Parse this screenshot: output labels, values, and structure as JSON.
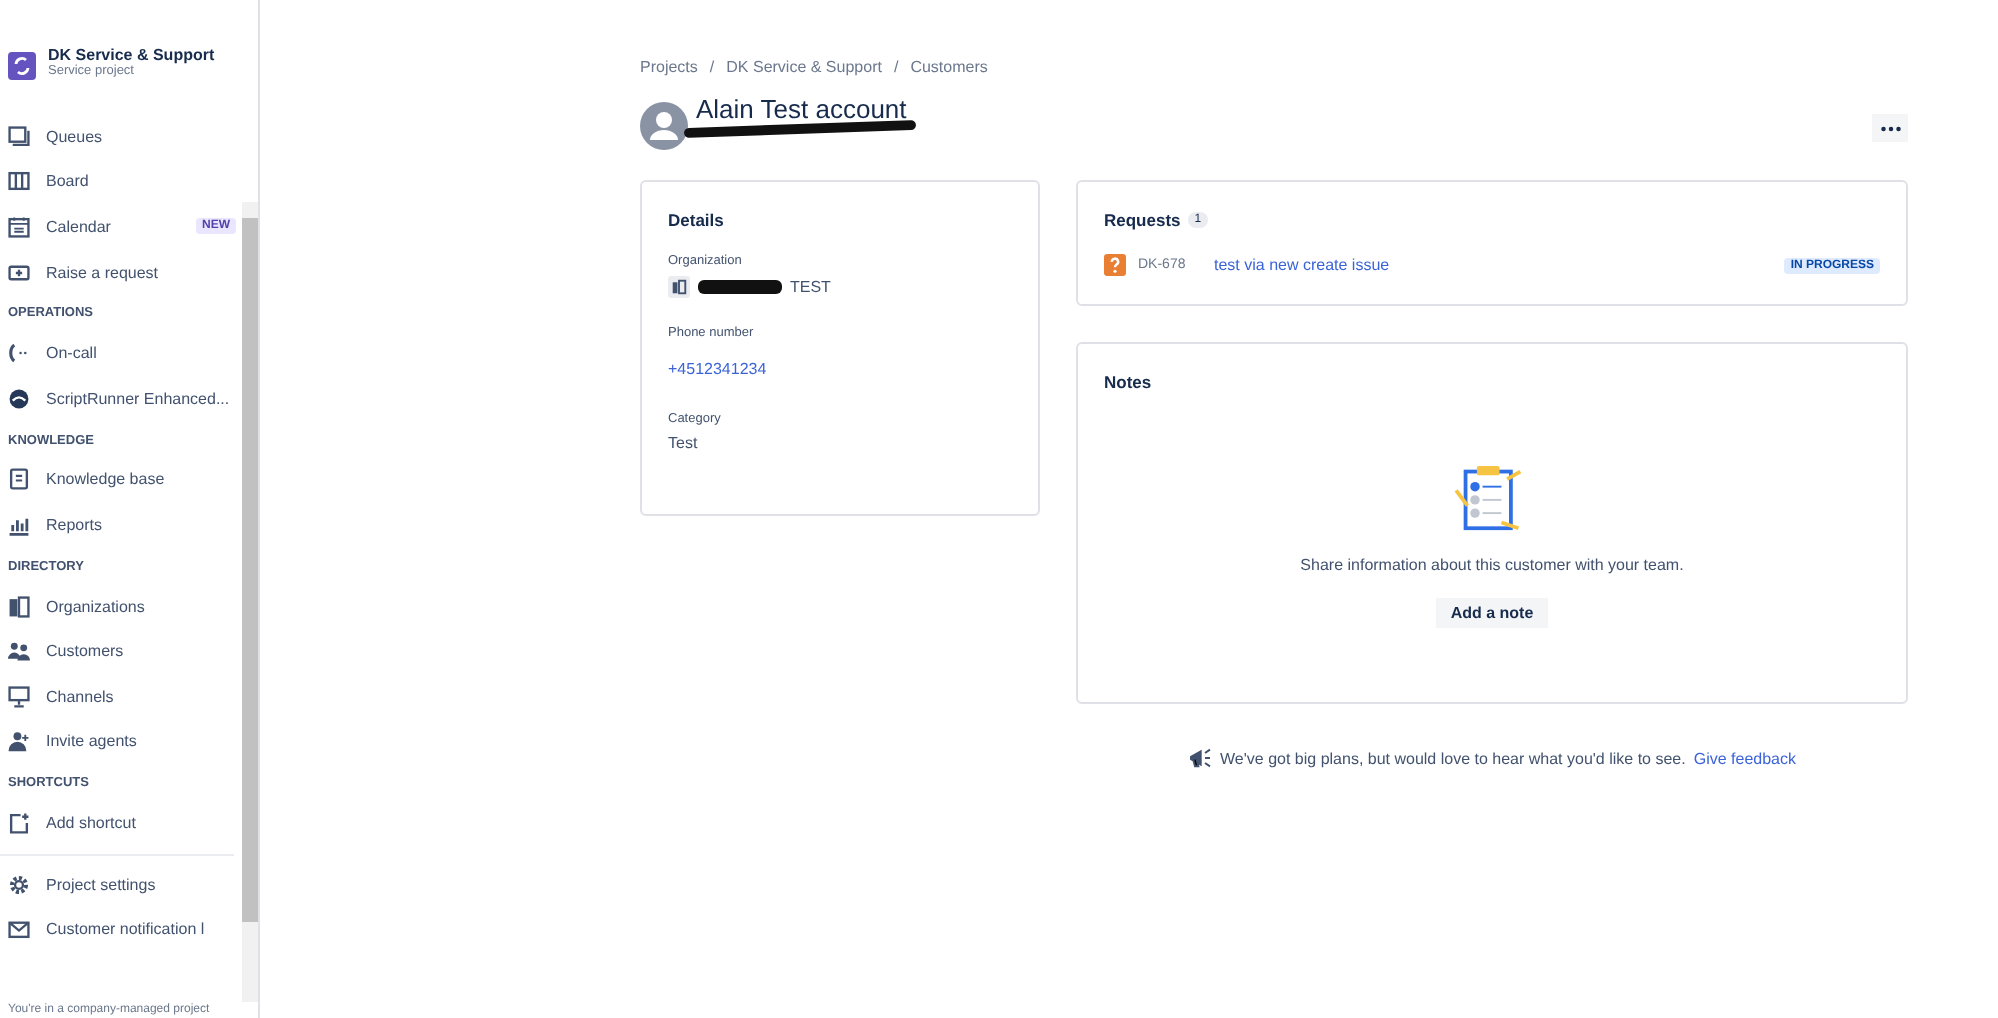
{
  "project": {
    "name": "DK Service & Support",
    "type": "Service project"
  },
  "sidebar": {
    "sections": [
      {
        "items": [
          {
            "label": "Queues",
            "kind": "queues"
          },
          {
            "label": "Board",
            "kind": "board"
          },
          {
            "label": "Calendar",
            "kind": "calendar",
            "badge": "NEW"
          },
          {
            "label": "Raise a request",
            "kind": "raise"
          }
        ]
      },
      {
        "heading": "OPERATIONS",
        "items": [
          {
            "label": "On-call",
            "kind": "oncall"
          },
          {
            "label": "ScriptRunner Enhanced...",
            "kind": "scriptrunner"
          }
        ]
      },
      {
        "heading": "KNOWLEDGE",
        "items": [
          {
            "label": "Knowledge base",
            "kind": "kb"
          },
          {
            "label": "Reports",
            "kind": "reports"
          }
        ]
      },
      {
        "heading": "DIRECTORY",
        "items": [
          {
            "label": "Organizations",
            "kind": "orgs"
          },
          {
            "label": "Customers",
            "kind": "customers"
          },
          {
            "label": "Channels",
            "kind": "channels"
          },
          {
            "label": "Invite agents",
            "kind": "invite"
          }
        ]
      },
      {
        "heading": "SHORTCUTS",
        "items": [
          {
            "label": "Add shortcut",
            "kind": "shortcut"
          }
        ]
      }
    ],
    "bottom_items": [
      {
        "label": "Project settings",
        "kind": "settings"
      },
      {
        "label": "Customer notification l",
        "kind": "mail"
      }
    ],
    "footer": "You're in a company-managed project"
  },
  "breadcrumbs": {
    "separator": "/",
    "items": [
      "Projects",
      "DK Service & Support",
      "Customers"
    ]
  },
  "customer": {
    "name": "Alain Test account"
  },
  "details": {
    "title": "Details",
    "fields": [
      {
        "label": "Organization",
        "value": "TEST",
        "kind": "org"
      },
      {
        "label": "Phone number",
        "value": "+4512341234",
        "kind": "link"
      },
      {
        "label": "Category",
        "value": "Test",
        "kind": "text"
      }
    ]
  },
  "requests": {
    "title": "Requests",
    "count": "1",
    "items": [
      {
        "key": "DK-678",
        "summary": "test via new create issue",
        "status": "IN PROGRESS"
      }
    ]
  },
  "notes": {
    "title": "Notes",
    "empty_text": "Share information about this customer with your team.",
    "button": "Add a note"
  },
  "feedback": {
    "text": "We've got big plans, but would love to hear what you'd like to see.",
    "link": "Give feedback"
  }
}
